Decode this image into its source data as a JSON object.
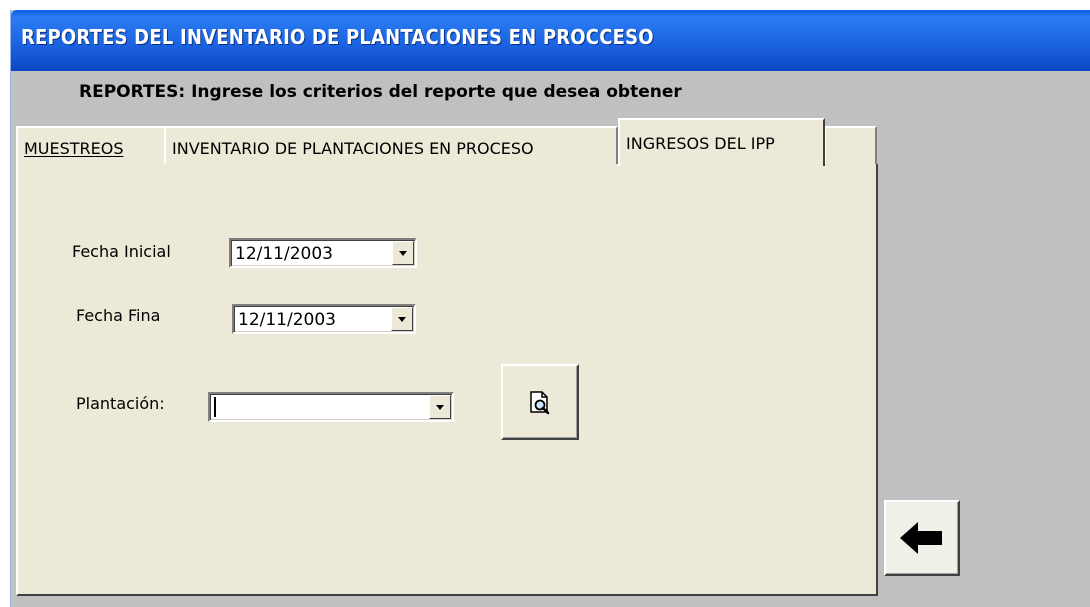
{
  "window": {
    "title": "REPORTES DEL INVENTARIO DE  PLANTACIONES EN PROCCESO"
  },
  "header": {
    "instruction": "REPORTES: Ingrese los criterios del reporte que desea obtener"
  },
  "tabs": [
    {
      "label": "MUESTREOS",
      "active": false
    },
    {
      "label": "INVENTARIO DE PLANTACIONES EN PROCESO",
      "active": false
    },
    {
      "label": "INGRESOS DEL IPP",
      "active": true
    }
  ],
  "form": {
    "fecha_inicial_label": "Fecha Inicial",
    "fecha_inicial_value": "12/11/2003",
    "fecha_final_label": "Fecha Fina",
    "fecha_final_value": "12/11/2003",
    "plantacion_label": "Plantación:",
    "plantacion_value": ""
  },
  "icons": {
    "preview": "print-preview-icon",
    "back": "back-arrow-icon",
    "dropdown": "chevron-down-icon"
  },
  "colors": {
    "titlebar": "#1f6ae6",
    "panel": "#ece9d8",
    "background": "#c0c0c0"
  }
}
